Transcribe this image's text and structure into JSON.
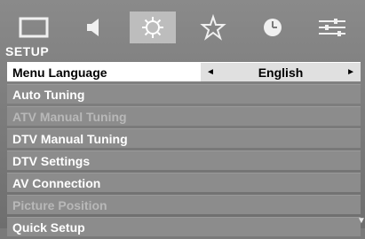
{
  "tabs": [
    {
      "icon": "picture-icon",
      "active": false
    },
    {
      "icon": "sound-icon",
      "active": false
    },
    {
      "icon": "setup-gear-icon",
      "active": true
    },
    {
      "icon": "preferences-star-icon",
      "active": false
    },
    {
      "icon": "timer-clock-icon",
      "active": false
    },
    {
      "icon": "options-sliders-icon",
      "active": false
    }
  ],
  "section_title": "SETUP",
  "menu": [
    {
      "label": "Menu Language",
      "value": "English",
      "selected": true,
      "disabled": false
    },
    {
      "label": "Auto Tuning",
      "selected": false,
      "disabled": false
    },
    {
      "label": "ATV Manual Tuning",
      "selected": false,
      "disabled": true
    },
    {
      "label": "DTV Manual Tuning",
      "selected": false,
      "disabled": false
    },
    {
      "label": "DTV Settings",
      "selected": false,
      "disabled": false
    },
    {
      "label": "AV Connection",
      "selected": false,
      "disabled": false
    },
    {
      "label": "Picture Position",
      "selected": false,
      "disabled": true
    },
    {
      "label": "Quick Setup",
      "selected": false,
      "disabled": false
    }
  ],
  "value_arrows": {
    "left": "◄",
    "right": "►"
  },
  "scroll_indicator": "▼",
  "colors": {
    "background": "#7a7a7a",
    "active_tab": "#bdbdbd",
    "selected_row": "#ffffff",
    "row": "#8c8c8c"
  }
}
